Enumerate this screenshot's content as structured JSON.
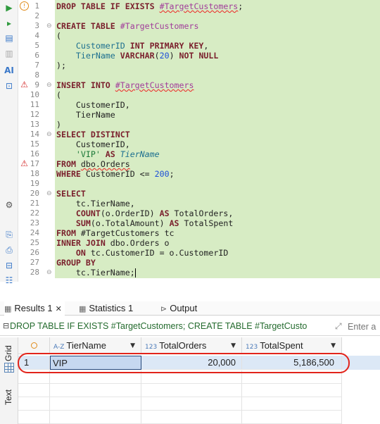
{
  "editor": {
    "lines": [
      {
        "n": "1",
        "segs": [
          [
            "kw",
            "DROP TABLE IF EXISTS "
          ],
          [
            "tmp squig",
            "#TargetCustomers"
          ],
          [
            "",
            "; "
          ]
        ]
      },
      {
        "n": "2",
        "segs": []
      },
      {
        "n": "3",
        "segs": [
          [
            "kw",
            "CREATE TABLE "
          ],
          [
            "tmp",
            "#TargetCustomers"
          ]
        ]
      },
      {
        "n": "4",
        "segs": [
          [
            "",
            "("
          ]
        ]
      },
      {
        "n": "5",
        "segs": [
          [
            "",
            "    "
          ],
          [
            "col",
            "CustomerID"
          ],
          [
            "kw",
            " INT PRIMARY KEY"
          ],
          [
            "",
            ","
          ]
        ]
      },
      {
        "n": "6",
        "segs": [
          [
            "",
            "    "
          ],
          [
            "col",
            "TierName"
          ],
          [
            "kw",
            " VARCHAR"
          ],
          [
            "",
            "("
          ],
          [
            "num",
            "20"
          ],
          [
            "",
            ") "
          ],
          [
            "kw",
            "NOT NULL"
          ]
        ]
      },
      {
        "n": "7",
        "segs": [
          [
            "",
            ");"
          ]
        ]
      },
      {
        "n": "8",
        "segs": []
      },
      {
        "n": "9",
        "segs": [
          [
            "kw",
            "INSERT INTO "
          ],
          [
            "tmp squig",
            "#TargetCustomers"
          ]
        ]
      },
      {
        "n": "10",
        "segs": [
          [
            "",
            "("
          ]
        ]
      },
      {
        "n": "11",
        "segs": [
          [
            "",
            "    CustomerID,"
          ]
        ]
      },
      {
        "n": "12",
        "segs": [
          [
            "",
            "    TierName"
          ]
        ]
      },
      {
        "n": "13",
        "segs": [
          [
            "",
            ")"
          ]
        ]
      },
      {
        "n": "14",
        "segs": [
          [
            "kw",
            "SELECT DISTINCT"
          ]
        ]
      },
      {
        "n": "15",
        "segs": [
          [
            "",
            "    CustomerID,"
          ]
        ]
      },
      {
        "n": "16",
        "segs": [
          [
            "",
            "    "
          ],
          [
            "str",
            "'VIP'"
          ],
          [
            "kw",
            " AS "
          ],
          [
            "ali",
            "TierName"
          ]
        ]
      },
      {
        "n": "17",
        "segs": [
          [
            "kw",
            "FROM "
          ],
          [
            "squig",
            "dbo.Orders"
          ]
        ]
      },
      {
        "n": "18",
        "segs": [
          [
            "kw",
            "WHERE "
          ],
          [
            "",
            "CustomerID <= "
          ],
          [
            "num",
            "200"
          ],
          [
            "",
            ";"
          ]
        ]
      },
      {
        "n": "19",
        "segs": []
      },
      {
        "n": "20",
        "segs": [
          [
            "kw",
            "SELECT"
          ]
        ]
      },
      {
        "n": "21",
        "segs": [
          [
            "",
            "    tc.TierName,"
          ]
        ]
      },
      {
        "n": "22",
        "segs": [
          [
            "",
            "    "
          ],
          [
            "kw",
            "COUNT"
          ],
          [
            "",
            "(o.OrderID) "
          ],
          [
            "kw",
            "AS"
          ],
          [
            "",
            " TotalOrders,"
          ]
        ]
      },
      {
        "n": "23",
        "segs": [
          [
            "",
            "    "
          ],
          [
            "kw",
            "SUM"
          ],
          [
            "",
            "(o.TotalAmount) "
          ],
          [
            "kw",
            "AS"
          ],
          [
            "",
            " TotalSpent"
          ]
        ]
      },
      {
        "n": "24",
        "segs": [
          [
            "kw",
            "FROM "
          ],
          [
            "",
            "#TargetCustomers tc"
          ]
        ]
      },
      {
        "n": "25",
        "segs": [
          [
            "kw",
            "INNER JOIN "
          ],
          [
            "",
            "dbo.Orders o"
          ]
        ]
      },
      {
        "n": "26",
        "segs": [
          [
            "",
            "    "
          ],
          [
            "kw",
            "ON "
          ],
          [
            "",
            "tc.CustomerID = o.CustomerID"
          ]
        ]
      },
      {
        "n": "27",
        "segs": [
          [
            "kw",
            "GROUP BY"
          ]
        ]
      },
      {
        "n": "28",
        "segs": [
          [
            "",
            "    tc.TierName;"
          ]
        ]
      }
    ],
    "markers": {
      "1": "info",
      "9": "warn",
      "17": "warn"
    },
    "fold_lines": [
      "3",
      "9",
      "14",
      "20",
      "28"
    ]
  },
  "toolstrip": {
    "icons": [
      "execute-icon",
      "execute-script-icon",
      "explain-plan-icon",
      "load-plan-icon",
      "ai-assistant-icon",
      "export-icon"
    ],
    "lower_icons": [
      "settings-icon",
      "format-icon",
      "save-script-icon",
      "load-script-icon",
      "outline-icon"
    ]
  },
  "results": {
    "tabs": [
      {
        "label": "Results 1",
        "icon": "table-icon",
        "closable": true
      },
      {
        "label": "Statistics 1",
        "icon": "table-icon",
        "closable": false
      },
      {
        "label": "Output",
        "icon": "output-icon",
        "closable": false
      }
    ],
    "query_text": "DROP TABLE IF EXISTS #TargetCustomers; CREATE TABLE #TargetCusto",
    "filter_placeholder": "Enter a",
    "side_tabs": {
      "grid": "Grid",
      "text": "Text"
    },
    "columns": [
      {
        "type": "A-Z",
        "name": "TierName"
      },
      {
        "type": "123",
        "name": "TotalOrders"
      },
      {
        "type": "123",
        "name": "TotalSpent"
      }
    ],
    "rows": [
      {
        "num": "1",
        "TierName": "VIP",
        "TotalOrders": "20,000",
        "TotalSpent": "5,186,500"
      }
    ]
  },
  "colors": {
    "editor_bg": "#d7ecc4",
    "keyword": "#7a1f2c",
    "highlight_ring": "#e2241b",
    "selected_cell": "#c6d8f0"
  }
}
